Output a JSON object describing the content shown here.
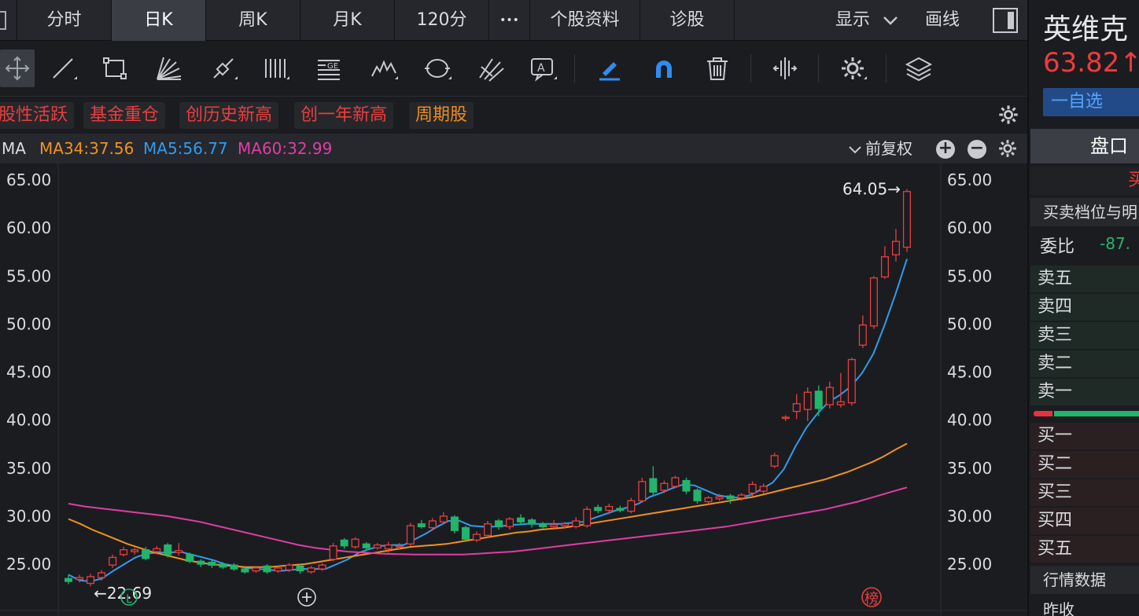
{
  "tabs": [
    {
      "label": "分时",
      "active": false
    },
    {
      "label": "日K",
      "active": true
    },
    {
      "label": "周K",
      "active": false
    },
    {
      "label": "月K",
      "active": false
    },
    {
      "label": "120分",
      "active": false
    },
    {
      "label": "•••",
      "active": false
    },
    {
      "label": "个股资料",
      "active": false
    },
    {
      "label": "诊股",
      "active": false
    }
  ],
  "toolbar_right": {
    "display_label": "显示",
    "draw_label": "画线"
  },
  "tools": [
    "move-cross-icon",
    "line-tool-icon",
    "rectangle-tool-icon",
    "fan-tool-icon",
    "trend-tool-icon",
    "parallel-lines-icon",
    "gann-box-icon",
    "wave-tool-icon",
    "cycle-tool-icon",
    "pitchfork-tool-icon",
    "text-annotation-icon",
    "highlighter-icon",
    "magnet-icon",
    "trash-icon",
    "split-view-icon",
    "settings-icon",
    "layers-icon"
  ],
  "tags": [
    {
      "label": "股性活跃",
      "color": "#ea3e3e"
    },
    {
      "label": "基金重仓",
      "color": "#ea3e3e"
    },
    {
      "label": "创历史新高",
      "color": "#ea3e3e"
    },
    {
      "label": "创一年新高",
      "color": "#ea3e3e"
    },
    {
      "label": "周期股",
      "color": "#ed8d1f"
    }
  ],
  "ma_bar": {
    "label": "MA",
    "ma34": "MA34:37.56",
    "ma5": "MA5:56.77",
    "ma60": "MA60:32.99",
    "adjust_label": "前复权",
    "colors": {
      "ma34": "#f0921e",
      "ma5": "#2f9bf0",
      "ma60": "#e13ca6"
    }
  },
  "chart_data": {
    "type": "candlestick",
    "y_ticks": [
      "65.00",
      "60.00",
      "55.00",
      "50.00",
      "45.00",
      "40.00",
      "35.00",
      "30.00",
      "25.00"
    ],
    "ylim": [
      21.0,
      66.5
    ],
    "grid": false,
    "high_label": "64.05→",
    "low_label": "←22.69",
    "marker_l": "L",
    "marker_bang": "榜",
    "colors": {
      "up": "#ea3e3e",
      "down": "#22b46c"
    },
    "candles": [
      {
        "o": 23.5,
        "c": 23.2,
        "h": 23.9,
        "l": 22.9
      },
      {
        "o": 23.4,
        "c": 23.6,
        "h": 23.9,
        "l": 23.1
      },
      {
        "o": 23.0,
        "c": 23.7,
        "h": 24.0,
        "l": 22.7
      },
      {
        "o": 23.6,
        "c": 24.1,
        "h": 24.4,
        "l": 23.3
      },
      {
        "o": 24.9,
        "c": 25.7,
        "h": 26.0,
        "l": 24.6
      },
      {
        "o": 26.0,
        "c": 26.5,
        "h": 26.8,
        "l": 25.8
      },
      {
        "o": 26.3,
        "c": 26.5,
        "h": 26.7,
        "l": 26.0
      },
      {
        "o": 26.5,
        "c": 25.6,
        "h": 26.8,
        "l": 25.4
      },
      {
        "o": 26.3,
        "c": 26.6,
        "h": 26.9,
        "l": 26.0
      },
      {
        "o": 27.0,
        "c": 26.0,
        "h": 27.2,
        "l": 25.7
      },
      {
        "o": 26.2,
        "c": 26.4,
        "h": 27.2,
        "l": 25.9
      },
      {
        "o": 26.0,
        "c": 25.3,
        "h": 26.2,
        "l": 25.1
      },
      {
        "o": 25.3,
        "c": 25.0,
        "h": 25.5,
        "l": 24.7
      },
      {
        "o": 25.2,
        "c": 24.9,
        "h": 25.4,
        "l": 24.6
      },
      {
        "o": 25.0,
        "c": 24.7,
        "h": 25.2,
        "l": 24.5
      },
      {
        "o": 24.9,
        "c": 24.5,
        "h": 25.1,
        "l": 24.3
      },
      {
        "o": 24.5,
        "c": 24.2,
        "h": 24.7,
        "l": 24.0
      },
      {
        "o": 24.3,
        "c": 24.6,
        "h": 24.8,
        "l": 24.1
      },
      {
        "o": 24.8,
        "c": 24.2,
        "h": 25.0,
        "l": 24.0
      },
      {
        "o": 24.3,
        "c": 24.6,
        "h": 24.8,
        "l": 24.1
      },
      {
        "o": 24.4,
        "c": 24.9,
        "h": 25.1,
        "l": 24.2
      },
      {
        "o": 24.8,
        "c": 24.3,
        "h": 25.0,
        "l": 24.0
      },
      {
        "o": 24.2,
        "c": 24.6,
        "h": 24.8,
        "l": 24.0
      },
      {
        "o": 24.5,
        "c": 24.9,
        "h": 25.1,
        "l": 24.3
      },
      {
        "o": 25.5,
        "c": 26.9,
        "h": 27.2,
        "l": 25.3
      },
      {
        "o": 27.5,
        "c": 26.9,
        "h": 27.7,
        "l": 26.6
      },
      {
        "o": 26.8,
        "c": 27.6,
        "h": 27.8,
        "l": 26.6
      },
      {
        "o": 27.1,
        "c": 26.7,
        "h": 27.3,
        "l": 26.4
      },
      {
        "o": 26.7,
        "c": 27.0,
        "h": 27.2,
        "l": 26.5
      },
      {
        "o": 26.6,
        "c": 27.0,
        "h": 27.3,
        "l": 26.2
      },
      {
        "o": 26.8,
        "c": 26.9,
        "h": 27.2,
        "l": 26.5
      },
      {
        "o": 27.1,
        "c": 29.0,
        "h": 29.3,
        "l": 26.9
      },
      {
        "o": 29.2,
        "c": 28.9,
        "h": 29.6,
        "l": 28.7
      },
      {
        "o": 28.8,
        "c": 29.5,
        "h": 29.8,
        "l": 28.5
      },
      {
        "o": 29.4,
        "c": 30.0,
        "h": 30.4,
        "l": 29.2
      },
      {
        "o": 29.9,
        "c": 28.5,
        "h": 30.1,
        "l": 28.2
      },
      {
        "o": 28.8,
        "c": 27.6,
        "h": 29.0,
        "l": 27.3
      },
      {
        "o": 27.5,
        "c": 28.1,
        "h": 28.4,
        "l": 27.3
      },
      {
        "o": 28.0,
        "c": 29.2,
        "h": 29.5,
        "l": 27.8
      },
      {
        "o": 29.5,
        "c": 28.9,
        "h": 29.7,
        "l": 28.6
      },
      {
        "o": 28.9,
        "c": 29.7,
        "h": 29.9,
        "l": 28.6
      },
      {
        "o": 29.8,
        "c": 29.4,
        "h": 30.2,
        "l": 29.1
      },
      {
        "o": 29.6,
        "c": 29.2,
        "h": 29.8,
        "l": 28.8
      },
      {
        "o": 29.2,
        "c": 28.9,
        "h": 29.4,
        "l": 28.7
      },
      {
        "o": 28.9,
        "c": 29.1,
        "h": 29.6,
        "l": 28.7
      },
      {
        "o": 29.0,
        "c": 29.2,
        "h": 29.4,
        "l": 28.7
      },
      {
        "o": 28.9,
        "c": 29.5,
        "h": 29.9,
        "l": 28.7
      },
      {
        "o": 29.0,
        "c": 30.7,
        "h": 31.0,
        "l": 28.8
      },
      {
        "o": 30.9,
        "c": 30.6,
        "h": 31.2,
        "l": 30.3
      },
      {
        "o": 30.6,
        "c": 31.0,
        "h": 31.3,
        "l": 30.2
      },
      {
        "o": 30.8,
        "c": 30.6,
        "h": 31.1,
        "l": 30.4
      },
      {
        "o": 30.5,
        "c": 31.6,
        "h": 31.9,
        "l": 30.3
      },
      {
        "o": 31.6,
        "c": 33.6,
        "h": 34.0,
        "l": 31.4
      },
      {
        "o": 33.9,
        "c": 32.5,
        "h": 35.2,
        "l": 32.1
      },
      {
        "o": 32.7,
        "c": 33.4,
        "h": 33.7,
        "l": 32.4
      },
      {
        "o": 33.1,
        "c": 34.0,
        "h": 34.2,
        "l": 32.9
      },
      {
        "o": 33.7,
        "c": 32.6,
        "h": 34.0,
        "l": 32.3
      },
      {
        "o": 32.7,
        "c": 31.6,
        "h": 32.9,
        "l": 31.3
      },
      {
        "o": 31.5,
        "c": 31.9,
        "h": 32.1,
        "l": 31.2
      },
      {
        "o": 31.8,
        "c": 32.0,
        "h": 32.3,
        "l": 31.6
      },
      {
        "o": 32.1,
        "c": 31.8,
        "h": 32.3,
        "l": 31.3
      },
      {
        "o": 31.9,
        "c": 32.2,
        "h": 32.4,
        "l": 31.6
      },
      {
        "o": 32.4,
        "c": 33.3,
        "h": 33.6,
        "l": 32.1
      },
      {
        "o": 32.6,
        "c": 33.1,
        "h": 33.4,
        "l": 32.3
      },
      {
        "o": 35.2,
        "c": 36.3,
        "h": 36.6,
        "l": 35.0
      },
      {
        "o": 40.2,
        "c": 40.3,
        "h": 40.5,
        "l": 39.9
      },
      {
        "o": 40.9,
        "c": 41.7,
        "h": 42.7,
        "l": 40.1
      },
      {
        "o": 41.1,
        "c": 42.9,
        "h": 43.4,
        "l": 39.9
      },
      {
        "o": 43.0,
        "c": 41.2,
        "h": 43.6,
        "l": 40.4
      },
      {
        "o": 41.6,
        "c": 43.4,
        "h": 44.0,
        "l": 41.2
      },
      {
        "o": 41.6,
        "c": 41.9,
        "h": 44.9,
        "l": 41.3
      },
      {
        "o": 41.8,
        "c": 46.3,
        "h": 46.5,
        "l": 41.5
      },
      {
        "o": 47.8,
        "c": 49.9,
        "h": 50.9,
        "l": 47.5
      },
      {
        "o": 49.8,
        "c": 54.8,
        "h": 55.0,
        "l": 49.5
      },
      {
        "o": 54.9,
        "c": 57.0,
        "h": 58.1,
        "l": 54.7
      },
      {
        "o": 57.2,
        "c": 58.6,
        "h": 59.9,
        "l": 56.5
      },
      {
        "o": 58.0,
        "c": 63.8,
        "h": 64.05,
        "l": 57.5
      }
    ],
    "series": [
      {
        "name": "MA5",
        "color": "#2f9bf0",
        "start": 0,
        "values": [
          23.9,
          23.3,
          23.2,
          23.5,
          24.3,
          25.0,
          25.7,
          26.1,
          26.2,
          26.2,
          26.3,
          26.0,
          25.7,
          25.4,
          25.0,
          24.8,
          24.6,
          24.5,
          24.4,
          24.3,
          24.4,
          24.5,
          24.5,
          24.5,
          25.0,
          25.5,
          26.2,
          26.6,
          26.9,
          27.0,
          27.0,
          27.6,
          28.2,
          28.9,
          29.5,
          29.5,
          29.0,
          28.9,
          28.9,
          29.0,
          29.1,
          29.2,
          29.2,
          29.2,
          29.2,
          29.3,
          29.4,
          29.8,
          30.2,
          30.6,
          30.9,
          31.3,
          32.0,
          32.4,
          32.9,
          33.3,
          33.2,
          32.7,
          32.2,
          32.0,
          31.9,
          32.2,
          32.8,
          33.5,
          34.9,
          37.2,
          39.2,
          40.7,
          41.9,
          42.6,
          43.5,
          44.9,
          46.9,
          49.9,
          53.2,
          56.77
        ]
      },
      {
        "name": "MA34",
        "color": "#f0921e",
        "start": 0,
        "values": [
          29.7,
          29.2,
          28.6,
          28.1,
          27.6,
          27.1,
          26.7,
          26.3,
          26.0,
          25.7,
          25.4,
          25.2,
          25.0,
          24.9,
          24.8,
          24.7,
          24.7,
          24.7,
          24.8,
          24.9,
          25.0,
          25.2,
          25.4,
          25.6,
          25.8,
          26.0,
          26.2,
          26.4,
          26.6,
          26.8,
          26.9,
          27.0,
          27.1,
          27.3,
          27.5,
          27.7,
          27.9,
          28.1,
          28.3,
          28.4,
          28.6,
          28.7,
          28.8,
          29.0,
          29.2,
          29.4,
          29.6,
          29.8,
          30.0,
          30.2,
          30.4,
          30.6,
          30.8,
          31.0,
          31.2,
          31.4,
          31.6,
          31.8,
          32.0,
          32.3,
          32.6,
          32.9,
          33.2,
          33.5,
          33.8,
          34.2,
          34.6,
          35.1,
          35.6,
          36.2,
          36.9,
          37.56
        ]
      },
      {
        "name": "MA60",
        "color": "#e13ca6",
        "start": 0,
        "values": [
          31.3,
          31.0,
          30.8,
          30.6,
          30.4,
          30.2,
          30.0,
          29.7,
          29.4,
          29.0,
          28.6,
          28.2,
          27.8,
          27.4,
          27.0,
          26.7,
          26.5,
          26.3,
          26.2,
          26.1,
          26.05,
          26.0,
          26.0,
          26.0,
          26.0,
          26.1,
          26.2,
          26.3,
          26.5,
          26.7,
          26.9,
          27.1,
          27.3,
          27.5,
          27.7,
          27.9,
          28.1,
          28.3,
          28.5,
          28.7,
          28.9,
          29.2,
          29.5,
          29.8,
          30.1,
          30.4,
          30.7,
          31.1,
          31.5,
          32.0,
          32.5,
          32.99
        ]
      }
    ]
  },
  "side": {
    "stock_name": "英维克",
    "price": "63.82↑",
    "watch_label": "一自选",
    "pankou_tab": "盘口",
    "buy_header": "买",
    "depth_title": "买卖档位与明",
    "weibi_label": "委比",
    "weibi_value": "-87.",
    "sell_levels": [
      "卖五",
      "卖四",
      "卖三",
      "卖二",
      "卖一"
    ],
    "buy_levels": [
      "买一",
      "买二",
      "买三",
      "买四",
      "买五"
    ],
    "quote_title": "行情数据",
    "prev_close_label": "昨收"
  }
}
